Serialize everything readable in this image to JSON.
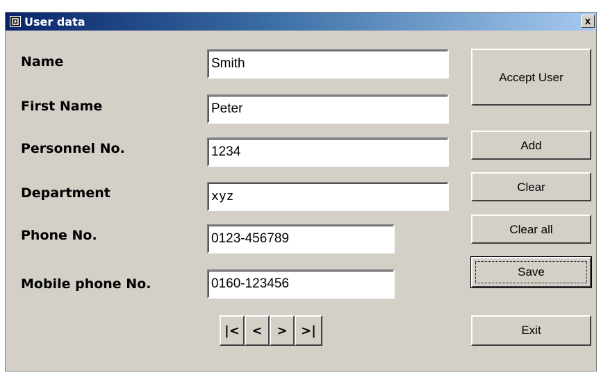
{
  "window": {
    "title": "User data",
    "close_symbol": "x",
    "app_icon": "user-data-app-icon",
    "colors": {
      "titlebar_start": "#0a246a",
      "titlebar_end": "#a6caf0",
      "face": "#d4d0c8"
    }
  },
  "form": {
    "name_label": "Name",
    "name_value": "Smith",
    "first_name_label": "First Name",
    "first_name_value": "Peter",
    "personnel_label": "Personnel No.",
    "personnel_value": "1234",
    "department_label": "Department",
    "department_value": "xyz",
    "phone_label": "Phone No.",
    "phone_value": "0123-456789",
    "mobile_label": "Mobile phone No.",
    "mobile_value": "0160-123456"
  },
  "buttons": {
    "accept_user": "Accept User",
    "add": "Add",
    "clear": "Clear",
    "clear_all": "Clear all",
    "save": "Save",
    "exit": "Exit"
  },
  "navigation": {
    "first": "|<",
    "prev": "<",
    "next": ">",
    "last": ">|"
  }
}
